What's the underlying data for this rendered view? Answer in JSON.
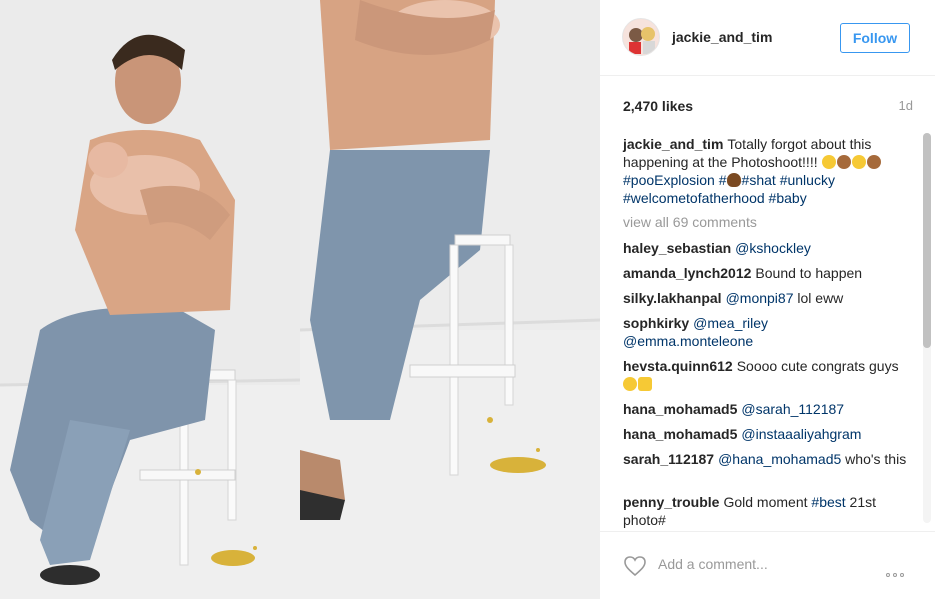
{
  "post": {
    "username": "jackie_and_tim",
    "follow_label": "Follow",
    "likes": "2,470 likes",
    "time_ago": "1d",
    "caption": {
      "user": "jackie_and_tim",
      "text": "Totally forgot about this happening at the Photoshoot!!!! ",
      "hashtags": [
        "#pooExplosion",
        "#",
        "#shat",
        "#unlucky",
        "#welcometofatherhood",
        "#baby"
      ]
    },
    "view_all": "view all 69 comments",
    "add_comment_placeholder": "Add a comment...",
    "icons": [
      "heart-icon",
      "more-options-icon",
      "avatar"
    ]
  },
  "comments": [
    {
      "user": "haley_sebastian",
      "text": "",
      "mention": "@kshockley"
    },
    {
      "user": "amanda_lynch2012",
      "text": "Bound to happen"
    },
    {
      "user": "silky.lakhanpal",
      "mention": "@monpi87",
      "text": " lol eww"
    },
    {
      "user": "sophkirky",
      "mention": "@mea_riley",
      "mention2": "@emma.monteleone"
    },
    {
      "user": "hevsta.quinn612",
      "text": "Soooo cute congrats guys"
    },
    {
      "user": "hana_mohamad5",
      "mention": "@sarah_112187"
    },
    {
      "user": "hana_mohamad5",
      "mention": "@instaaaliyahgram"
    },
    {
      "user": "sarah_112187",
      "mention": "@hana_mohamad5",
      "text": " who's this"
    },
    {
      "user": "penny_trouble",
      "text": "Gold moment ",
      "hashtag": "#best",
      "text2": " 21st photo#"
    }
  ],
  "colors": {
    "accent": "#3897f0",
    "link": "#003569",
    "muted": "#999999",
    "text": "#262626"
  }
}
